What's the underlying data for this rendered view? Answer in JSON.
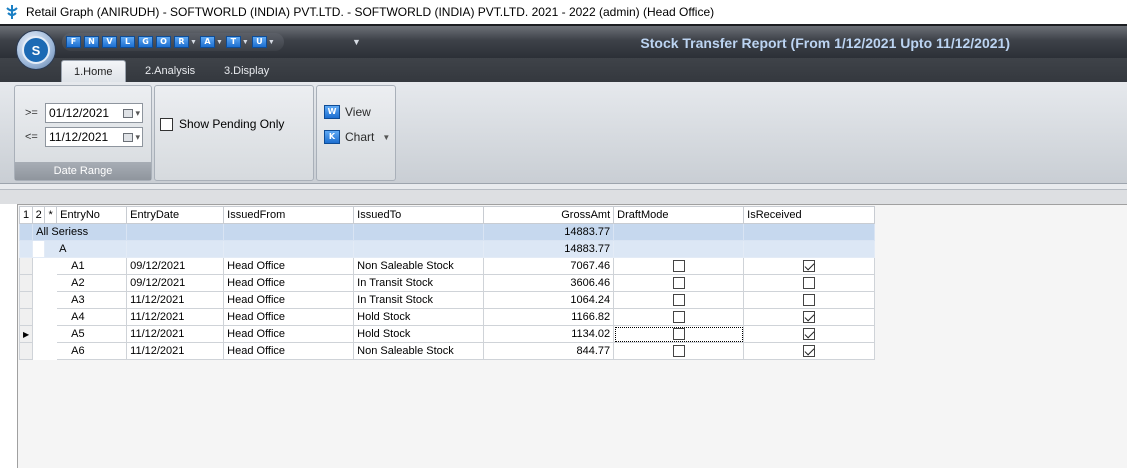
{
  "window": {
    "title": "Retail Graph (ANIRUDH) - SOFTWORLD (INDIA) PVT.LTD. - SOFTWORLD (INDIA) PVT.LTD.  2021 - 2022 (admin) (Head Office)"
  },
  "quick_access": [
    {
      "icon": "F",
      "name": "qat-f"
    },
    {
      "icon": "N",
      "name": "qat-n"
    },
    {
      "icon": "V",
      "name": "qat-v"
    },
    {
      "icon": "L",
      "name": "qat-l"
    },
    {
      "icon": "G",
      "name": "qat-g"
    },
    {
      "icon": "O",
      "name": "qat-o"
    },
    {
      "icon": "R",
      "name": "qat-r"
    },
    {
      "icon": "A",
      "name": "qat-a"
    },
    {
      "icon": "T",
      "name": "qat-t"
    },
    {
      "icon": "U",
      "name": "qat-u"
    }
  ],
  "app_logo_text": "S",
  "report_title": "Stock Transfer Report (From 1/12/2021 Upto 11/12/2021)",
  "tabs": [
    {
      "label": "1.Home",
      "active": true
    },
    {
      "label": "2.Analysis",
      "active": false
    },
    {
      "label": "3.Display",
      "active": false
    }
  ],
  "date_range": {
    "from_op": ">=",
    "from_value": "01/12/2021",
    "to_op": "<=",
    "to_value": "11/12/2021",
    "group_label": "Date Range"
  },
  "show_pending": {
    "label": "Show Pending Only",
    "checked": false
  },
  "actions": {
    "view_label": "View",
    "chart_label": "Chart"
  },
  "grid": {
    "level_headers": [
      "1",
      "2",
      "*"
    ],
    "columns": [
      "EntryNo",
      "EntryDate",
      "IssuedFrom",
      "IssuedTo",
      "GrossAmt",
      "DraftMode",
      "IsReceived"
    ],
    "group_row": {
      "label": "All Seriess",
      "gross": "14883.77"
    },
    "sub_row": {
      "label": "A",
      "gross": "14883.77"
    },
    "rows": [
      {
        "entry_no": "A1",
        "entry_date": "09/12/2021",
        "issued_from": "Head Office",
        "issued_to": "Non Saleable Stock",
        "gross": "7067.46",
        "draft": false,
        "received": true
      },
      {
        "entry_no": "A2",
        "entry_date": "09/12/2021",
        "issued_from": "Head Office",
        "issued_to": "In Transit Stock",
        "gross": "3606.46",
        "draft": false,
        "received": false
      },
      {
        "entry_no": "A3",
        "entry_date": "11/12/2021",
        "issued_from": "Head Office",
        "issued_to": "In Transit Stock",
        "gross": "1064.24",
        "draft": false,
        "received": false
      },
      {
        "entry_no": "A4",
        "entry_date": "11/12/2021",
        "issued_from": "Head Office",
        "issued_to": "Hold Stock",
        "gross": "1166.82",
        "draft": false,
        "received": true
      },
      {
        "entry_no": "A5",
        "entry_date": "11/12/2021",
        "issued_from": "Head Office",
        "issued_to": "Hold Stock",
        "gross": "1134.02",
        "draft": false,
        "received": true,
        "current": true
      },
      {
        "entry_no": "A6",
        "entry_date": "11/12/2021",
        "issued_from": "Head Office",
        "issued_to": "Non Saleable Stock",
        "gross": "844.77",
        "draft": false,
        "received": true
      }
    ]
  }
}
